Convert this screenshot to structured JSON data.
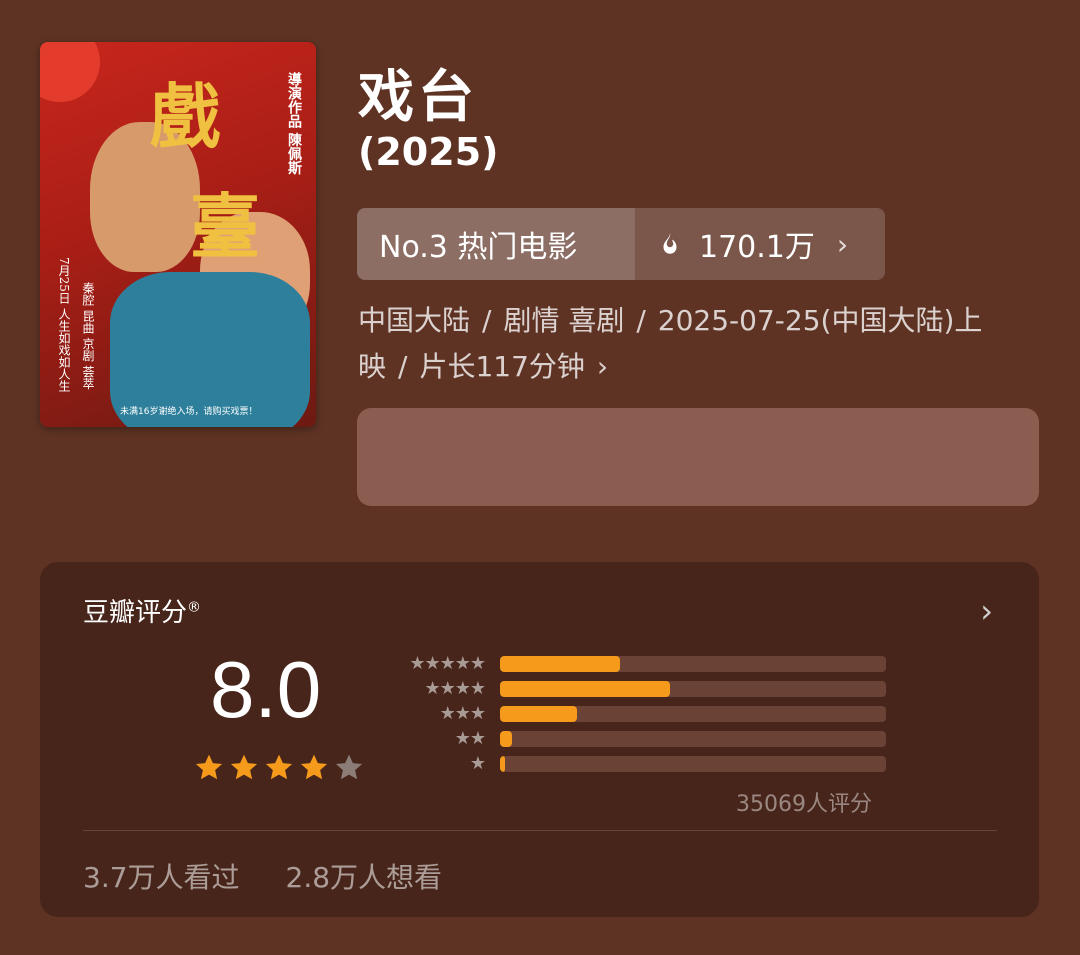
{
  "movie": {
    "title": "戏台",
    "year": "(2025)",
    "rank_label": "No.3 热门电影",
    "heat_value": "170.1万",
    "meta_line_1_parts": [
      "中国大陆",
      "/",
      "剧情 喜剧",
      "/",
      "2025-07-25(中国大陆)上"
    ],
    "meta_line_2_parts": [
      "映",
      "/",
      "片长117分钟"
    ],
    "icons": {
      "heat": "fire-icon",
      "chevron": "chevron-right-icon"
    }
  },
  "poster": {
    "glyph_1": "戲",
    "glyph_2": "臺",
    "director_text": "導演作品 陳佩斯",
    "release_text": "7月25日 人生如戏如人生",
    "tagline_text": "秦腔 昆曲 京剧 荟萃",
    "footer_text": "未满16岁谢绝入场，请购买戏票！"
  },
  "rating": {
    "title": "豆瓣评分",
    "registered_mark": "®",
    "score": "8.0",
    "stars_filled": 4,
    "stars_total": 5,
    "distribution": [
      {
        "stars": "★★★★★",
        "fraction": 0.31
      },
      {
        "stars": "★★★★",
        "fraction": 0.44
      },
      {
        "stars": "★★★",
        "fraction": 0.2
      },
      {
        "stars": "★★",
        "fraction": 0.03
      },
      {
        "stars": "★",
        "fraction": 0.005
      }
    ],
    "count_text": "35069人评分",
    "watched": "3.7万人看过",
    "want": "2.8万人想看"
  },
  "colors": {
    "background": "#5e3324",
    "card": "#47251a",
    "accent_orange": "#f69a1c",
    "star_empty": "#8c7c77"
  }
}
